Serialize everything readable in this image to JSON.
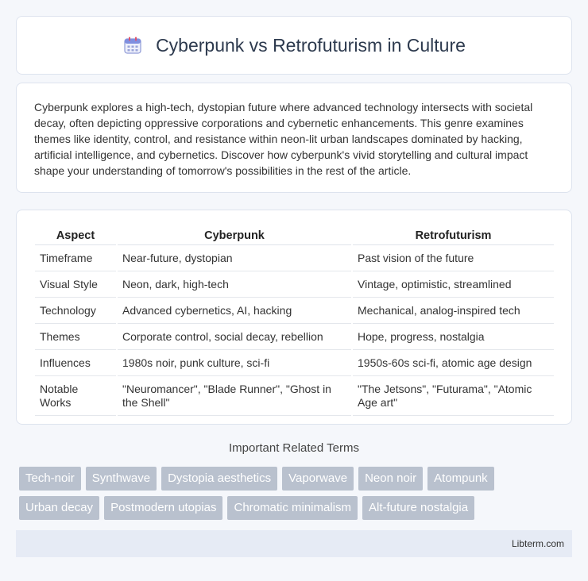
{
  "header": {
    "title": "Cyberpunk vs Retrofuturism in Culture",
    "icon": "calendar-icon"
  },
  "intro": {
    "text": "Cyberpunk explores a high-tech, dystopian future where advanced technology intersects with societal decay, often depicting oppressive corporations and cybernetic enhancements. This genre examines themes like identity, control, and resistance within neon-lit urban landscapes dominated by hacking, artificial intelligence, and cybernetics. Discover how cyberpunk's vivid storytelling and cultural impact shape your understanding of tomorrow's possibilities in the rest of the article."
  },
  "table": {
    "headers": [
      "Aspect",
      "Cyberpunk",
      "Retrofuturism"
    ],
    "rows": [
      [
        "Timeframe",
        "Near-future, dystopian",
        "Past vision of the future"
      ],
      [
        "Visual Style",
        "Neon, dark, high-tech",
        "Vintage, optimistic, streamlined"
      ],
      [
        "Technology",
        "Advanced cybernetics, AI, hacking",
        "Mechanical, analog-inspired tech"
      ],
      [
        "Themes",
        "Corporate control, social decay, rebellion",
        "Hope, progress, nostalgia"
      ],
      [
        "Influences",
        "1980s noir, punk culture, sci-fi",
        "1950s-60s sci-fi, atomic age design"
      ],
      [
        "Notable Works",
        "\"Neuromancer\", \"Blade Runner\", \"Ghost in the Shell\"",
        "\"The Jetsons\", \"Futurama\", \"Atomic Age art\""
      ]
    ]
  },
  "related": {
    "title": "Important Related Terms",
    "tags": [
      "Tech-noir",
      "Synthwave",
      "Dystopia aesthetics",
      "Vaporwave",
      "Neon noir",
      "Atompunk",
      "Urban decay",
      "Postmodern utopias",
      "Chromatic minimalism",
      "Alt-future nostalgia"
    ]
  },
  "footer": {
    "text": "Libterm.com"
  },
  "colors": {
    "tag_bg": "#b9c1ce",
    "footer_bg": "#e6ebf5",
    "title": "#2d3a4e"
  }
}
